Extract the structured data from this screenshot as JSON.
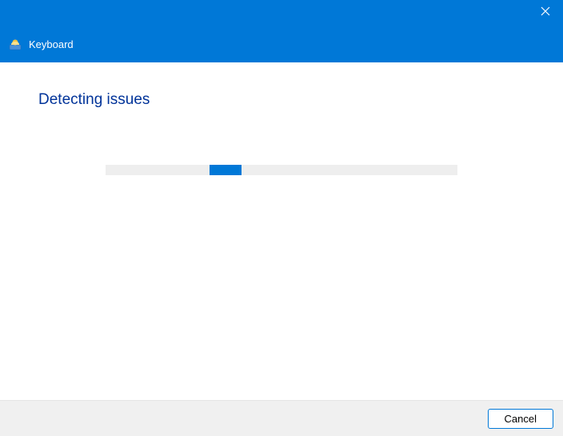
{
  "header": {
    "title": "Keyboard",
    "icon_name": "troubleshooter-icon"
  },
  "content": {
    "heading": "Detecting issues"
  },
  "footer": {
    "cancel_label": "Cancel"
  }
}
